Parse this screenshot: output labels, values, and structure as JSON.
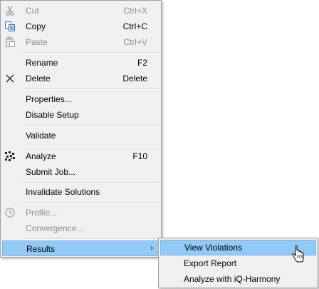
{
  "menu": {
    "items": [
      {
        "label": "Cut",
        "shortcut": "Ctrl+X",
        "icon": "scissors-icon",
        "disabled": true
      },
      {
        "label": "Copy",
        "shortcut": "Ctrl+C",
        "icon": "copy-icon",
        "disabled": false
      },
      {
        "label": "Paste",
        "shortcut": "Ctrl+V",
        "icon": "paste-icon",
        "disabled": true
      },
      {
        "label": "Rename",
        "shortcut": "F2",
        "icon": "",
        "disabled": false
      },
      {
        "label": "Delete",
        "shortcut": "Delete",
        "icon": "delete-x-icon",
        "disabled": false
      },
      {
        "label": "Properties...",
        "shortcut": "",
        "icon": "",
        "disabled": false
      },
      {
        "label": "Disable Setup",
        "shortcut": "",
        "icon": "",
        "disabled": false
      },
      {
        "label": "Validate",
        "shortcut": "",
        "icon": "",
        "disabled": false
      },
      {
        "label": "Analyze",
        "shortcut": "F10",
        "icon": "analyze-icon",
        "disabled": false
      },
      {
        "label": "Submit Job...",
        "shortcut": "",
        "icon": "",
        "disabled": false
      },
      {
        "label": "Invalidate Solutions",
        "shortcut": "",
        "icon": "",
        "disabled": false
      },
      {
        "label": "Profile...",
        "shortcut": "",
        "icon": "clock-icon",
        "disabled": true
      },
      {
        "label": "Convergence...",
        "shortcut": "",
        "icon": "",
        "disabled": true
      },
      {
        "label": "Results",
        "shortcut": "",
        "icon": "",
        "disabled": false,
        "submenu_arrow": "›"
      }
    ]
  },
  "submenu": {
    "items": [
      {
        "label": "View Violations"
      },
      {
        "label": "Export Report"
      },
      {
        "label": "Analyze with iQ-Harmony"
      }
    ]
  },
  "colors": {
    "menu_bg": "#f0f0f0",
    "highlight": "#91c9f7",
    "disabled_text": "#8d8d8d"
  }
}
